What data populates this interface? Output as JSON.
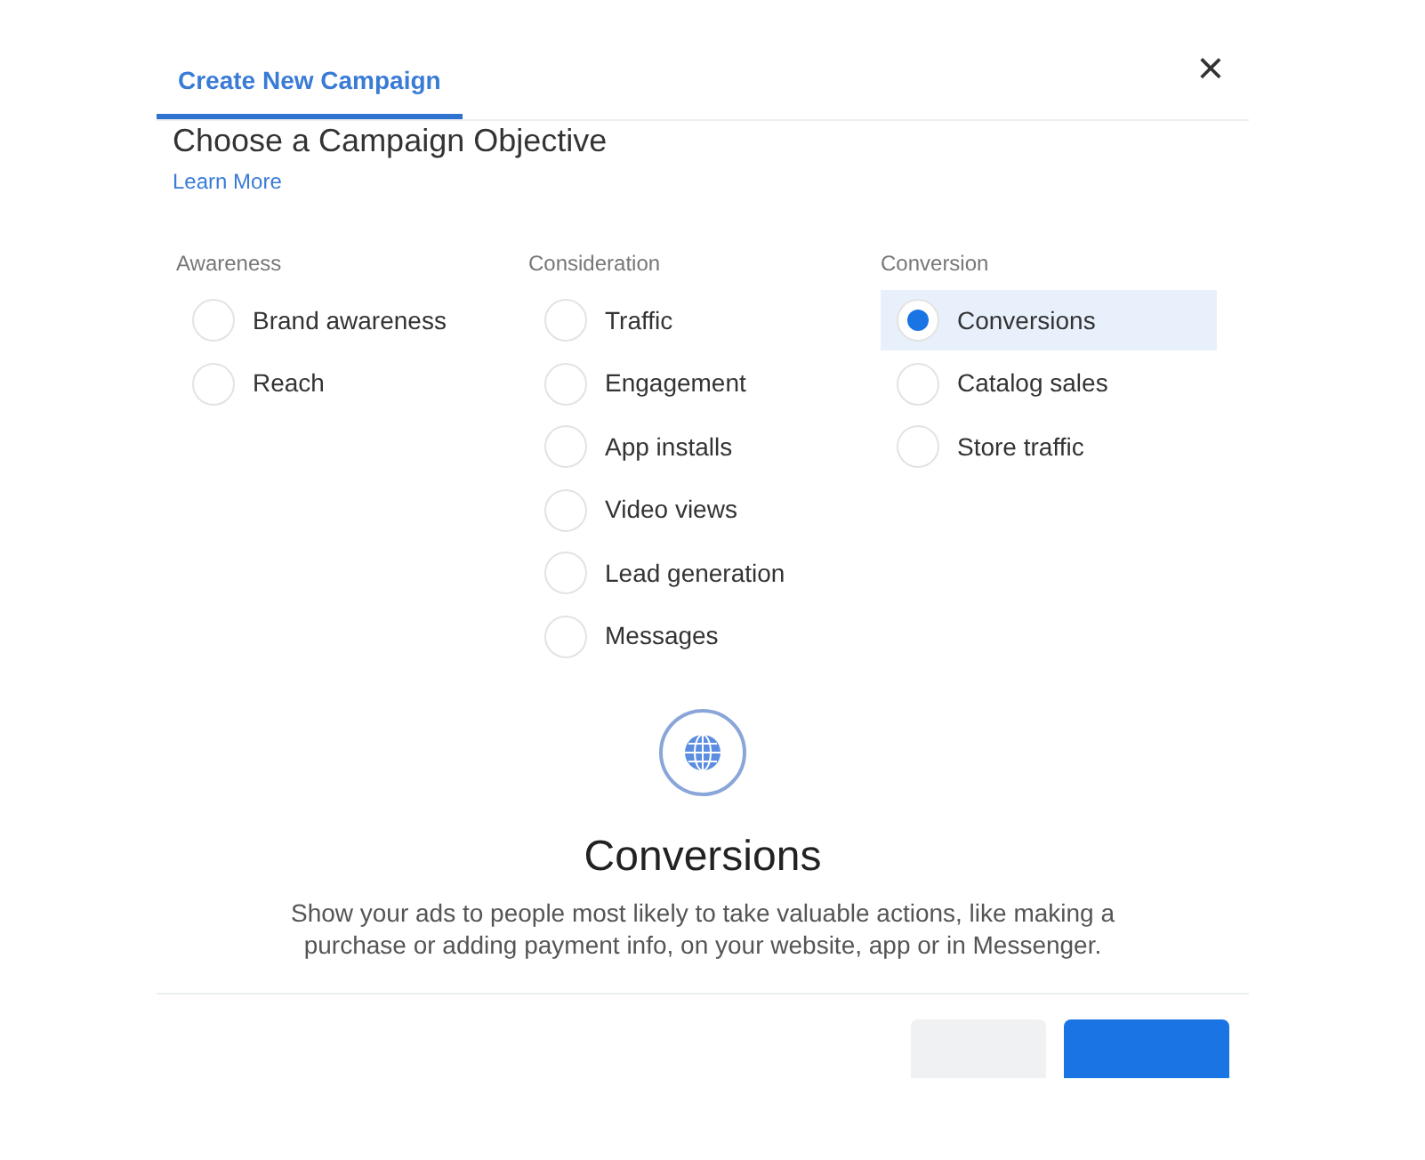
{
  "tabs": [
    {
      "label": "Create New Campaign",
      "selected": true
    }
  ],
  "close": {
    "glyph": "×"
  },
  "heading": "Choose a Campaign Objective",
  "learn_more": "Learn More",
  "groups": [
    {
      "title": "Awareness",
      "options": [
        {
          "label": "Brand awareness",
          "selected": false
        },
        {
          "label": "Reach",
          "selected": false
        }
      ]
    },
    {
      "title": "Consideration",
      "options": [
        {
          "label": "Traffic",
          "selected": false
        },
        {
          "label": "Engagement",
          "selected": false
        },
        {
          "label": "App installs",
          "selected": false
        },
        {
          "label": "Video views",
          "selected": false
        },
        {
          "label": "Lead generation",
          "selected": false
        },
        {
          "label": "Messages",
          "selected": false
        }
      ]
    },
    {
      "title": "Conversion",
      "options": [
        {
          "label": "Conversions",
          "selected": true
        },
        {
          "label": "Catalog sales",
          "selected": false
        },
        {
          "label": "Store traffic",
          "selected": false
        }
      ]
    }
  ],
  "detail": {
    "title": "Conversions",
    "description": "Show your ads to people most likely to take valuable actions, like making a purchase or adding payment info, on your website, app or in Messenger."
  },
  "buttons": [
    {
      "kind": "secondary"
    },
    {
      "kind": "primary"
    }
  ]
}
